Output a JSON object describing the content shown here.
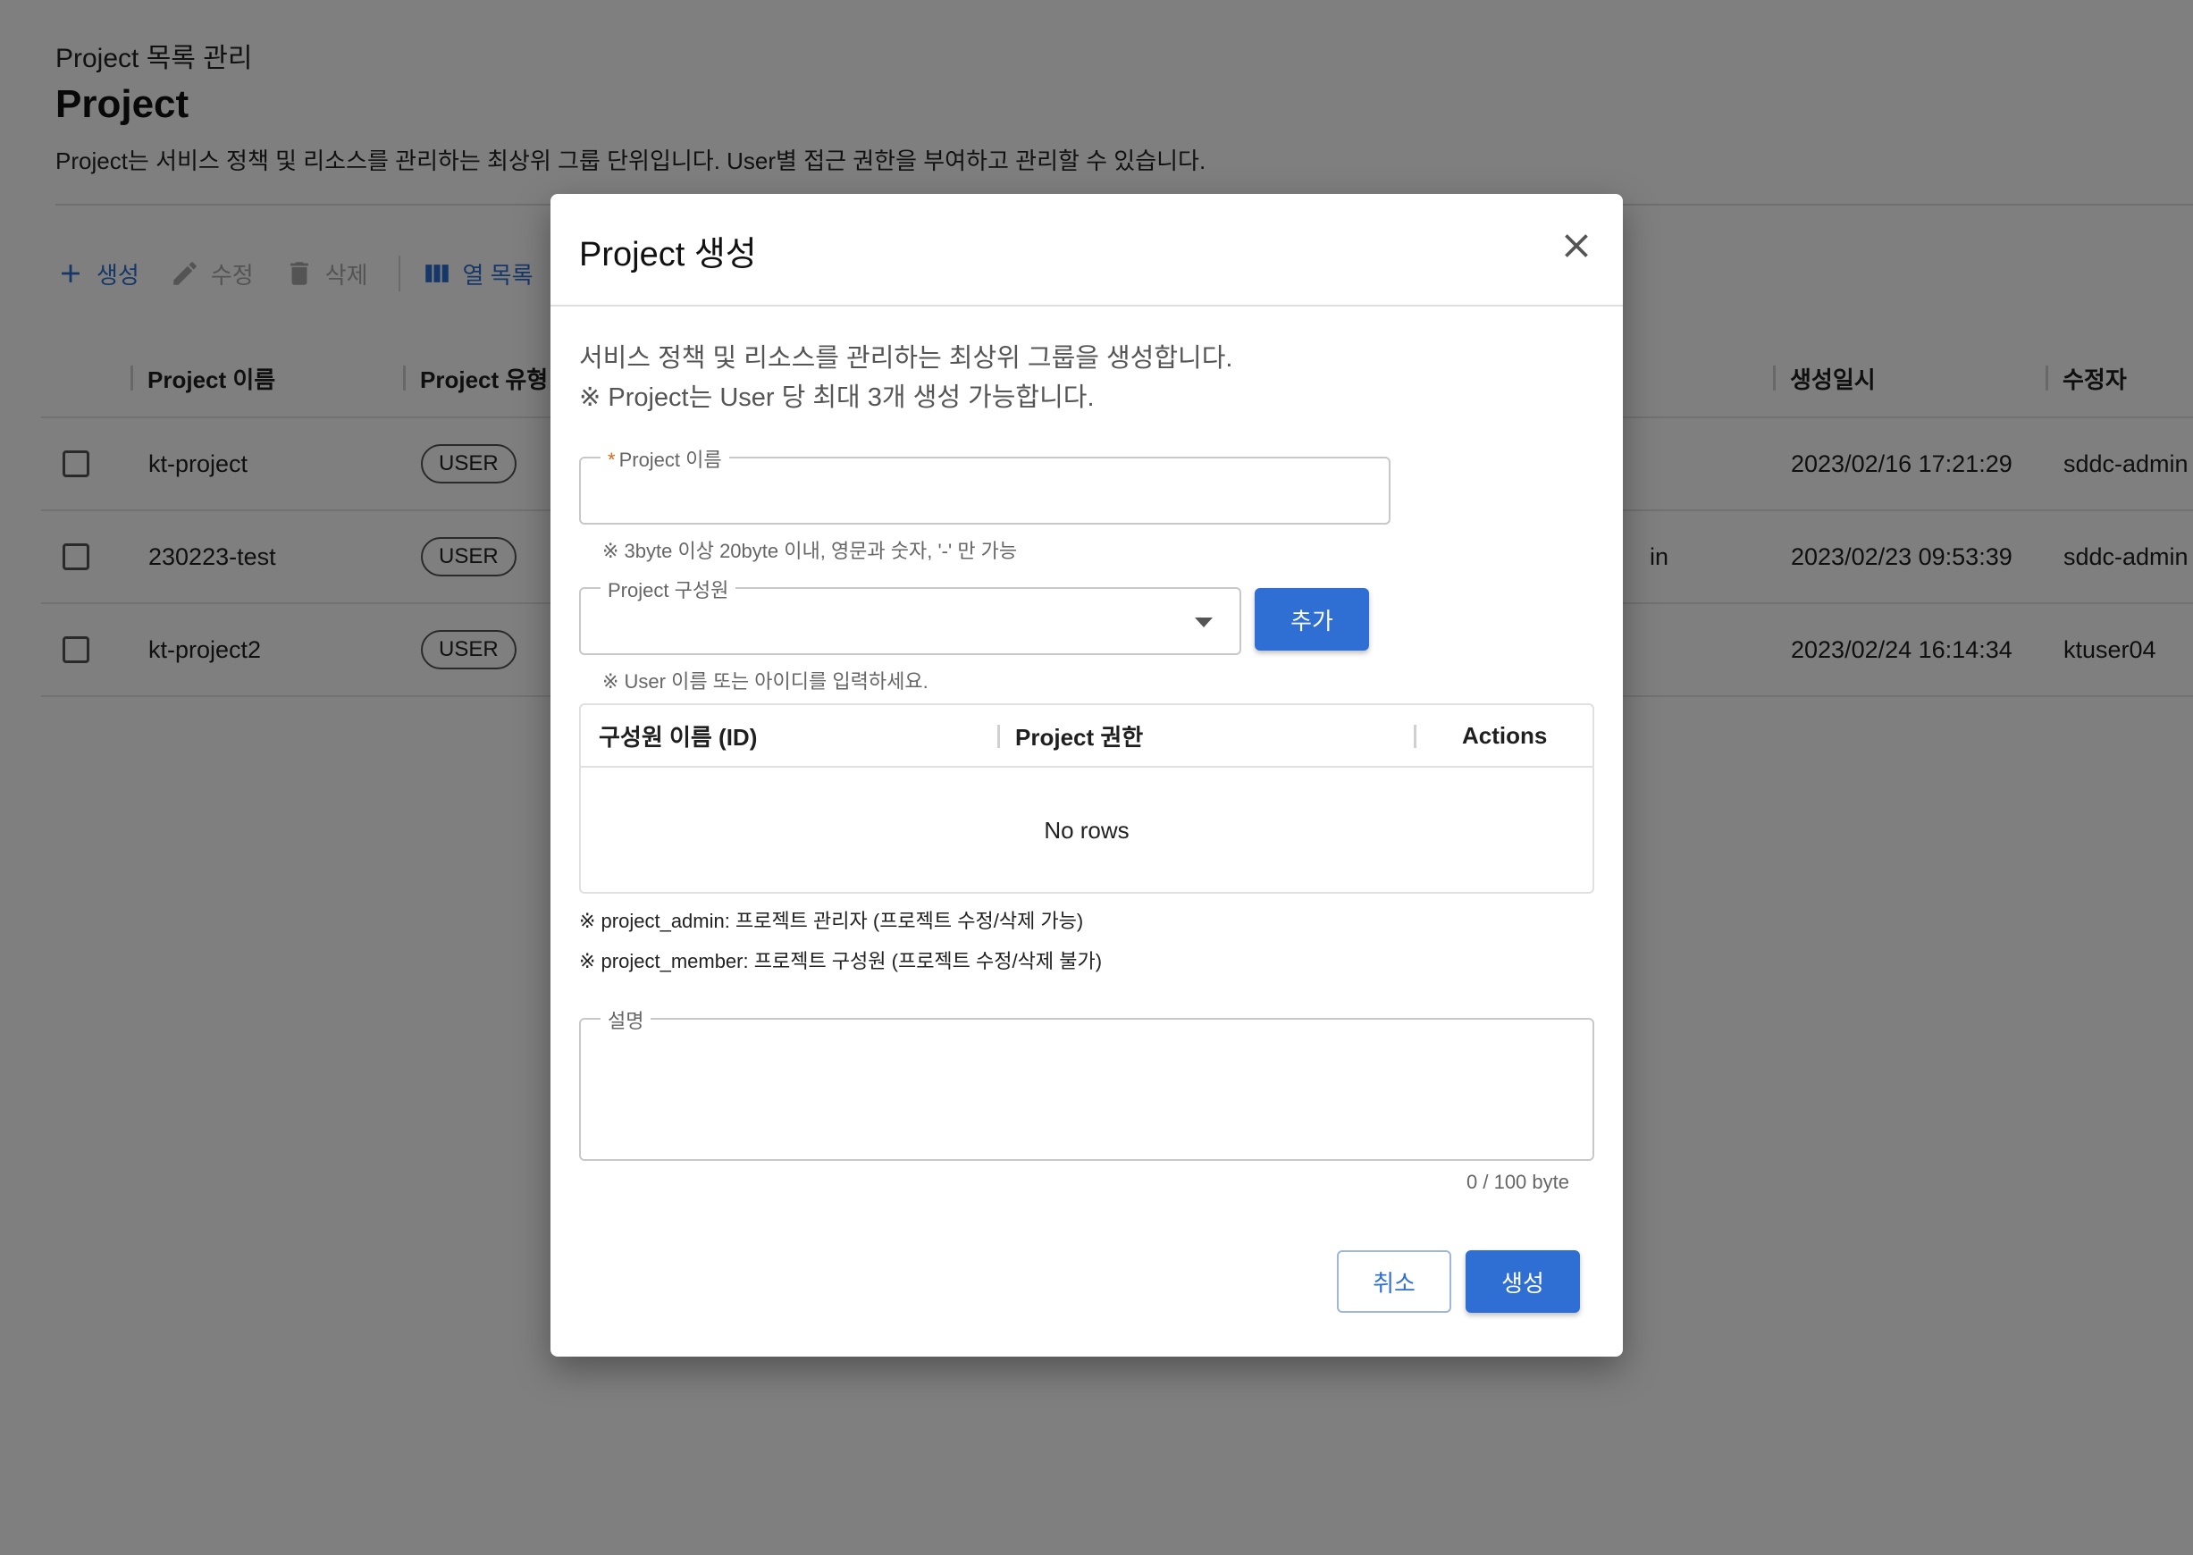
{
  "page": {
    "breadcrumb": "Project 목록 관리",
    "title": "Project",
    "description": "Project는 서비스 정책 및 리소스를 관리하는 최상위 그룹 단위입니다. User별 접근 권한을 부여하고 관리할 수 있습니다."
  },
  "toolbar": {
    "create": "생성",
    "edit": "수정",
    "delete": "삭제",
    "columns": "열 목록"
  },
  "table": {
    "columns": [
      "Project 이름",
      "Project 유형",
      "생성일시",
      "수정자"
    ],
    "rows": [
      {
        "name": "kt-project",
        "type": "USER",
        "hidden_partial": "",
        "created": "2023/02/16 17:21:29",
        "modifier": "sddc-admin"
      },
      {
        "name": "230223-test",
        "type": "USER",
        "hidden_partial": "in",
        "created": "2023/02/23 09:53:39",
        "modifier": "sddc-admin"
      },
      {
        "name": "kt-project2",
        "type": "USER",
        "hidden_partial": "",
        "created": "2023/02/24 16:14:34",
        "modifier": "ktuser04"
      }
    ]
  },
  "modal": {
    "title": "Project 생성",
    "intro_line1": "서비스 정책 및 리소스를 관리하는 최상위 그룹을 생성합니다.",
    "intro_line2": "※ Project는 User 당 최대 3개 생성 가능합니다.",
    "name_field": {
      "label": "Project 이름",
      "required_mark": "*",
      "value": "",
      "helper": "※ 3byte 이상 20byte 이내, 영문과 숫자, '-' 만 가능"
    },
    "member_field": {
      "label": "Project 구성원",
      "value": "",
      "helper": "※ User 이름 또는 아이디를 입력하세요."
    },
    "add_button": "추가",
    "grid": {
      "headers": [
        "구성원 이름 (ID)",
        "Project 권한",
        "Actions"
      ],
      "empty_text": "No rows"
    },
    "role_notes": [
      "※ project_admin: 프로젝트 관리자 (프로젝트 수정/삭제 가능)",
      "※ project_member: 프로젝트 구성원 (프로젝트 수정/삭제 불가)"
    ],
    "description_field": {
      "label": "설명",
      "value": "",
      "counter": "0 / 100 byte"
    },
    "cancel_button": "취소",
    "submit_button": "생성"
  },
  "colors": {
    "accent": "#2f6fd3",
    "required": "#e0671b",
    "overlay": "rgba(0,0,0,0.5)"
  }
}
